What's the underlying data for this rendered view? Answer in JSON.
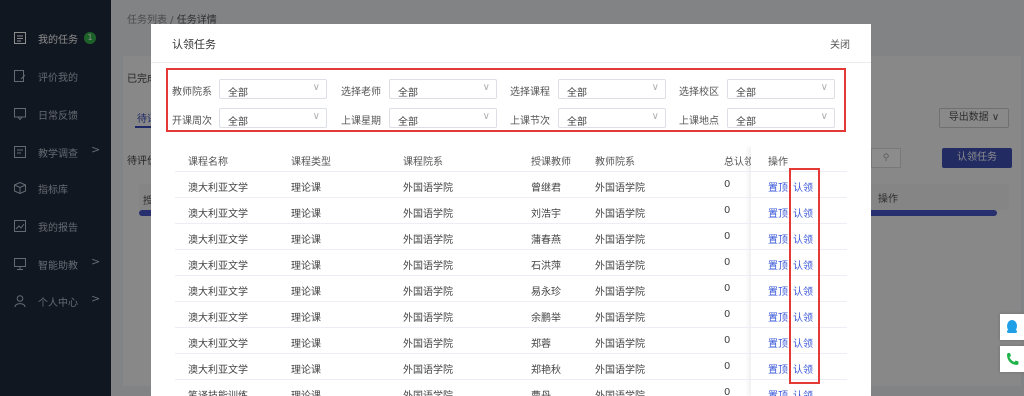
{
  "sidebar": {
    "items": [
      {
        "label": "我的任务",
        "icon": "task-list-icon",
        "badge": "1",
        "arrow": ""
      },
      {
        "label": "评价我的",
        "icon": "evaluation-icon",
        "badge": "",
        "arrow": ""
      },
      {
        "label": "日常反馈",
        "icon": "feedback-icon",
        "badge": "",
        "arrow": ""
      },
      {
        "label": "教学调查",
        "icon": "survey-icon",
        "badge": "",
        "arrow": ">"
      },
      {
        "label": "指标库",
        "icon": "cube-icon",
        "badge": "",
        "arrow": ""
      },
      {
        "label": "我的报告",
        "icon": "report-icon",
        "badge": "",
        "arrow": ""
      },
      {
        "label": "智能助教",
        "icon": "monitor-icon",
        "badge": "",
        "arrow": ">"
      },
      {
        "label": "个人中心",
        "icon": "user-icon",
        "badge": "",
        "arrow": ">"
      }
    ]
  },
  "background": {
    "breadcrumb_parent": "任务列表 /",
    "breadcrumb_current": "任务详情",
    "completed_label": "已完成",
    "tab_label": "待评",
    "pending_label": "待评价",
    "export_label": "导出数据 ∨",
    "claim_button": "认领任务",
    "table_header_left": "授",
    "table_header_op": "操作"
  },
  "modal": {
    "title": "认领任务",
    "close": "关闭",
    "filters": [
      {
        "label": "教师院系",
        "value": "全部"
      },
      {
        "label": "选择老师",
        "value": "全部"
      },
      {
        "label": "选择课程",
        "value": "全部"
      },
      {
        "label": "选择校区",
        "value": "全部"
      },
      {
        "label": "开课周次",
        "value": "全部"
      },
      {
        "label": "上课星期",
        "value": "全部"
      },
      {
        "label": "上课节次",
        "value": "全部"
      },
      {
        "label": "上课地点",
        "value": "全部"
      }
    ],
    "table": {
      "headers": [
        "课程名称",
        "课程类型",
        "课程院系",
        "授课教师",
        "教师院系",
        "总认领",
        "操作"
      ],
      "rows": [
        {
          "course": "澳大利亚文学",
          "type": "理论课",
          "dept": "外国语学院",
          "teacher": "曾继君",
          "tdept": "外国语学院",
          "count": "0",
          "top": "置顶",
          "claim": "认领"
        },
        {
          "course": "澳大利亚文学",
          "type": "理论课",
          "dept": "外国语学院",
          "teacher": "刘浩宇",
          "tdept": "外国语学院",
          "count": "0",
          "top": "置顶",
          "claim": "认领"
        },
        {
          "course": "澳大利亚文学",
          "type": "理论课",
          "dept": "外国语学院",
          "teacher": "蒲春燕",
          "tdept": "外国语学院",
          "count": "0",
          "top": "置顶",
          "claim": "认领"
        },
        {
          "course": "澳大利亚文学",
          "type": "理论课",
          "dept": "外国语学院",
          "teacher": "石洪萍",
          "tdept": "外国语学院",
          "count": "0",
          "top": "置顶",
          "claim": "认领"
        },
        {
          "course": "澳大利亚文学",
          "type": "理论课",
          "dept": "外国语学院",
          "teacher": "易永珍",
          "tdept": "外国语学院",
          "count": "0",
          "top": "置顶",
          "claim": "认领"
        },
        {
          "course": "澳大利亚文学",
          "type": "理论课",
          "dept": "外国语学院",
          "teacher": "余鹏举",
          "tdept": "外国语学院",
          "count": "0",
          "top": "置顶",
          "claim": "认领"
        },
        {
          "course": "澳大利亚文学",
          "type": "理论课",
          "dept": "外国语学院",
          "teacher": "郑蓉",
          "tdept": "外国语学院",
          "count": "0",
          "top": "置顶",
          "claim": "认领"
        },
        {
          "course": "澳大利亚文学",
          "type": "理论课",
          "dept": "外国语学院",
          "teacher": "郑艳秋",
          "tdept": "外国语学院",
          "count": "0",
          "top": "置顶",
          "claim": "认领"
        },
        {
          "course": "笔译技能训练",
          "type": "理论课",
          "dept": "外国语学院",
          "teacher": "曹丹",
          "tdept": "外国语学院",
          "count": "0",
          "top": "置顶",
          "claim": "认领"
        }
      ]
    }
  },
  "colors": {
    "sidebar_bg": "#1f2a3c",
    "accent": "#3f51b5",
    "link": "#3a57d8",
    "highlight": "#e53935",
    "badge": "#34b34a"
  }
}
